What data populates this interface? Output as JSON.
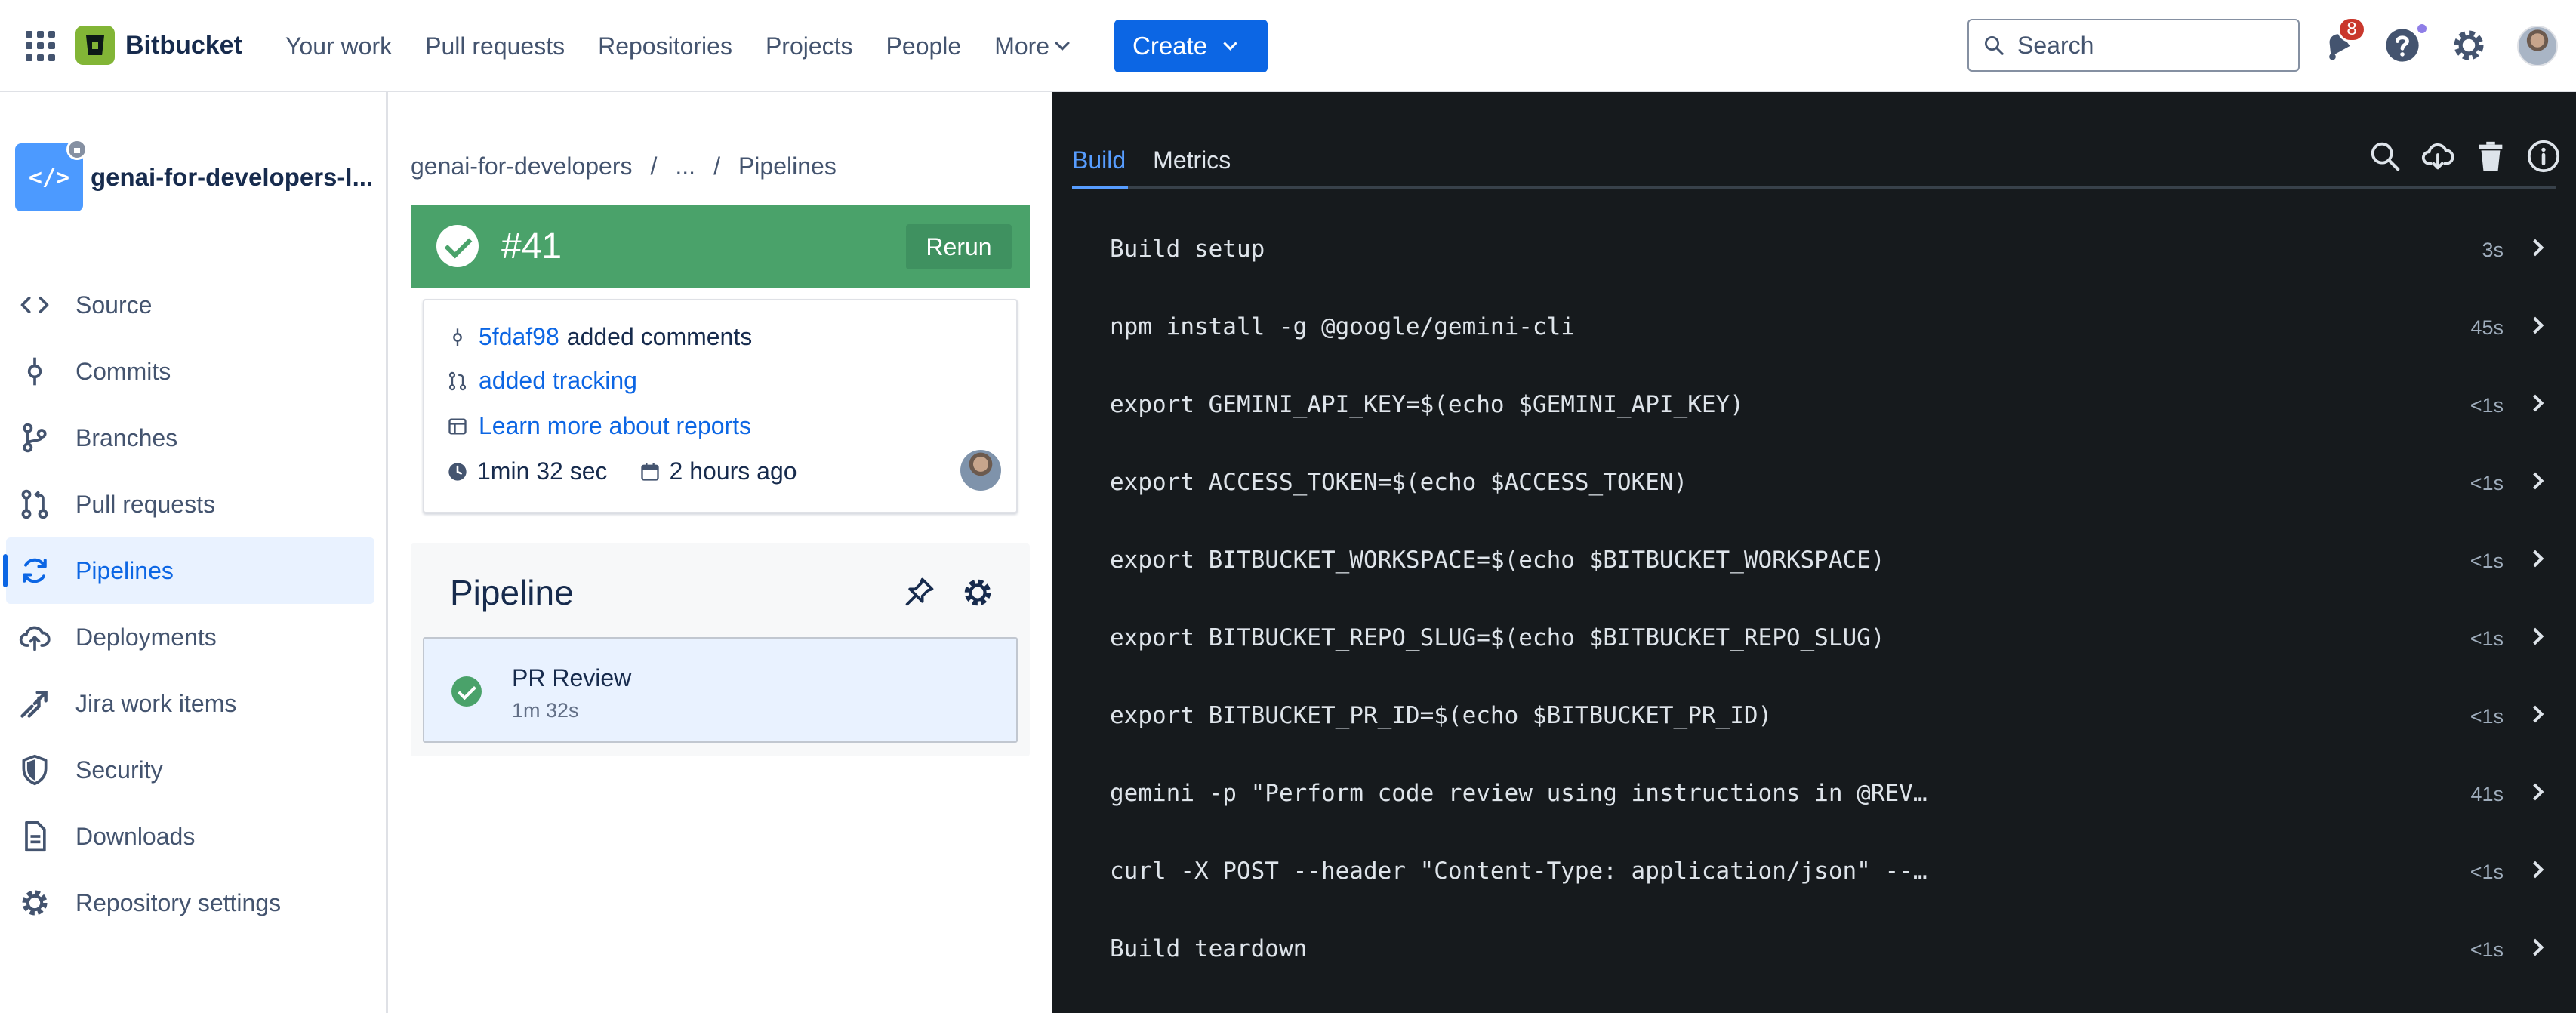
{
  "app": {
    "name": "Bitbucket"
  },
  "nav": {
    "items": [
      "Your work",
      "Pull requests",
      "Repositories",
      "Projects",
      "People"
    ],
    "more": "More",
    "create": "Create",
    "search_placeholder": "Search",
    "notification_count": "8"
  },
  "sidebar": {
    "repo_name": "genai-for-developers-l...",
    "items": [
      {
        "label": "Source",
        "icon": "code-icon"
      },
      {
        "label": "Commits",
        "icon": "commit-icon"
      },
      {
        "label": "Branches",
        "icon": "branch-icon"
      },
      {
        "label": "Pull requests",
        "icon": "pull-request-icon"
      },
      {
        "label": "Pipelines",
        "icon": "pipelines-icon",
        "active": true
      },
      {
        "label": "Deployments",
        "icon": "cloud-upload-icon"
      },
      {
        "label": "Jira work items",
        "icon": "jira-icon"
      },
      {
        "label": "Security",
        "icon": "shield-icon"
      },
      {
        "label": "Downloads",
        "icon": "file-icon"
      },
      {
        "label": "Repository settings",
        "icon": "gear-icon"
      }
    ]
  },
  "breadcrumb": {
    "repo": "genai-for-developers",
    "ellipsis": "...",
    "page": "Pipelines"
  },
  "build": {
    "number": "#41",
    "rerun": "Rerun",
    "commit_hash": "5fdaf98",
    "commit_message": "added comments",
    "pr_link": "added tracking",
    "reports_link": "Learn more about reports",
    "duration": "1min 32 sec",
    "time_ago": "2 hours ago",
    "status_color": "#4aa26a"
  },
  "pipeline": {
    "title": "Pipeline",
    "step_name": "PR Review",
    "step_duration": "1m 32s"
  },
  "log": {
    "tabs": [
      "Build",
      "Metrics"
    ],
    "steps": [
      {
        "command": "Build setup",
        "duration": "3s"
      },
      {
        "command": "npm install -g @google/gemini-cli",
        "duration": "45s"
      },
      {
        "command": "export GEMINI_API_KEY=$(echo $GEMINI_API_KEY)",
        "duration": "<1s"
      },
      {
        "command": "export ACCESS_TOKEN=$(echo $ACCESS_TOKEN)",
        "duration": "<1s"
      },
      {
        "command": "export BITBUCKET_WORKSPACE=$(echo $BITBUCKET_WORKSPACE)",
        "duration": "<1s"
      },
      {
        "command": "export BITBUCKET_REPO_SLUG=$(echo $BITBUCKET_REPO_SLUG)",
        "duration": "<1s"
      },
      {
        "command": "export BITBUCKET_PR_ID=$(echo $BITBUCKET_PR_ID)",
        "duration": "<1s"
      },
      {
        "command": "gemini -p \"Perform code review using instructions in @REVIEW.md\" -y",
        "duration": "41s"
      },
      {
        "command": "curl -X POST --header \"Content-Type: application/json\" --header \"Authorization: Bearer $ACCESS_TOKEN\"",
        "duration": "<1s"
      },
      {
        "command": "Build teardown",
        "duration": "<1s"
      }
    ]
  }
}
